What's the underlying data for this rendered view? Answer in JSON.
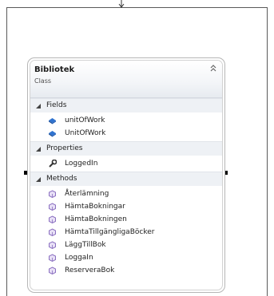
{
  "class": {
    "name": "Bibliotek",
    "kind": "Class",
    "collapse_icon": "double-chevron-up-icon"
  },
  "sections": {
    "fields": {
      "label": "Fields",
      "items": [
        "unitOfWork",
        "UnitOfWork"
      ],
      "icon": "field-icon"
    },
    "properties": {
      "label": "Properties",
      "items": [
        "LoggedIn"
      ],
      "icon": "property-wrench-icon"
    },
    "methods": {
      "label": "Methods",
      "items": [
        "Återlämning",
        "HämtaBokningar",
        "HämtaBokningen",
        "HämtaTillgängligaBöcker",
        "LäggTillBok",
        "LoggaIn",
        "ReserveraBok"
      ],
      "icon": "method-icon"
    }
  },
  "colors": {
    "field": "#2f73d0",
    "method": "#8a6fc0",
    "property": "#333333"
  }
}
